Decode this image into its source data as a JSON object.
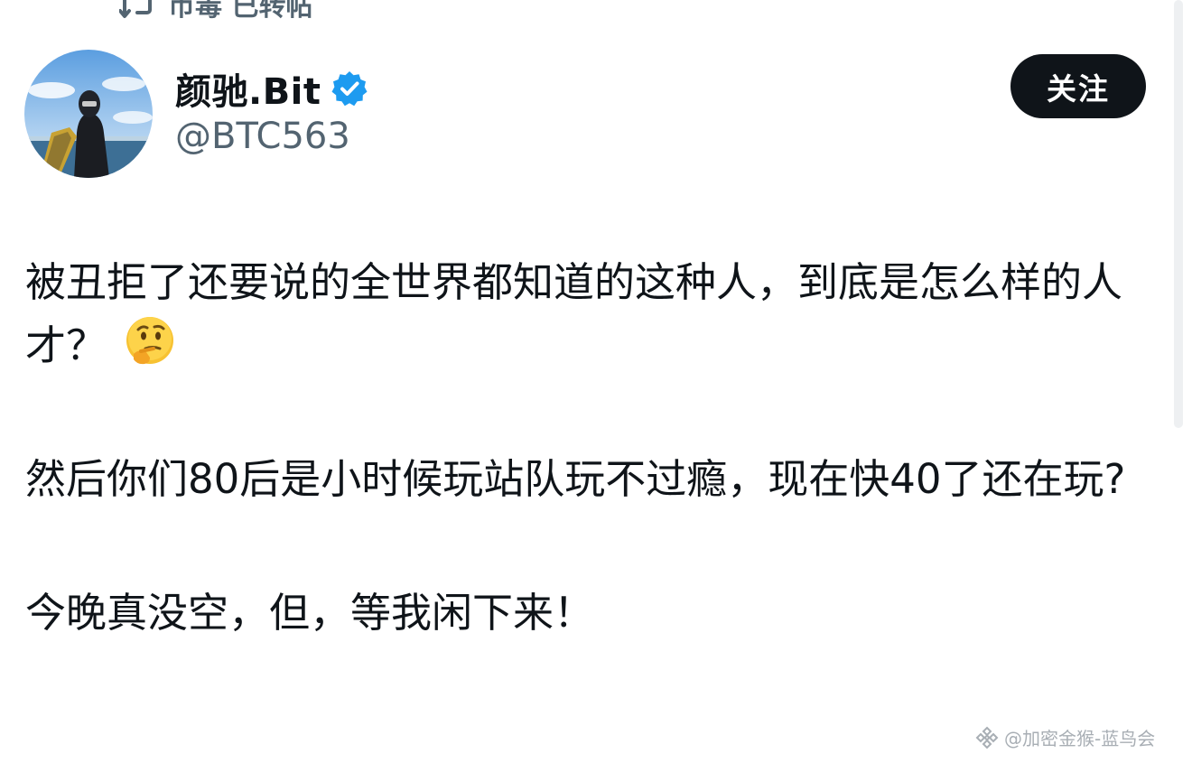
{
  "repost": {
    "icon": "repost-icon",
    "text": "币毒 已转帖"
  },
  "author": {
    "display_name": "颜驰.Bit",
    "handle": "@BTC563",
    "verified": true,
    "verified_color": "#1d9bf0"
  },
  "follow_button": {
    "label": "关注"
  },
  "tweet": {
    "paragraphs": [
      "被丑拒了还要说的全世界都知道的这种人，到底是怎么样的人才？",
      "然后你们80后是小时候玩站队玩不过瘾，现在快40了还在玩?",
      "今晚真没空，但，等我闲下来！"
    ],
    "emoji": "thinking-face-emoji"
  },
  "watermark": {
    "text": "@加密金猴-蓝鸟会"
  },
  "colors": {
    "text_primary": "#0f1419",
    "text_secondary": "#536471",
    "follow_bg": "#0f1419",
    "follow_fg": "#ffffff"
  }
}
